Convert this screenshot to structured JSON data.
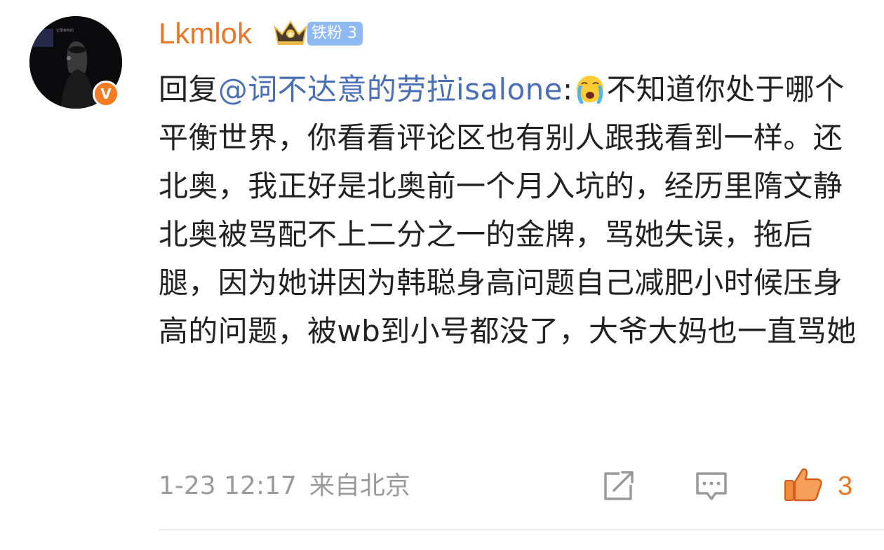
{
  "user": {
    "name": "Lkmlok",
    "fan_badge": "铁粉 3",
    "verified_mark": "V",
    "avatar_caption": "记录审判的",
    "name_color": "#e8772b"
  },
  "comment": {
    "reply_prefix": "回复",
    "mention": "@词不达意的劳拉isalone",
    "separator": ":",
    "emoji": "crying-emoji",
    "body": "不知道你处于哪个平衡世界，你看看评论区也有别人跟我看到一样。还北奥，我正好是北奥前一个月入坑的，经历里隋文静北奥被骂配不上二分之一的金牌，骂她失误，拖后腿，因为她讲因为韩聪身高问题自己减肥小时候压身高的问题，被wb到小号都没了，大爷大妈也一直骂她",
    "mention_color": "#4a6fb4"
  },
  "meta": {
    "timestamp": "1-23 12:17",
    "location": "来自北京"
  },
  "actions": {
    "repost_icon": "share-icon",
    "comment_icon": "comment-icon",
    "like_icon": "thumbs-up-icon",
    "like_count": "3",
    "accent": "#e8772b"
  }
}
